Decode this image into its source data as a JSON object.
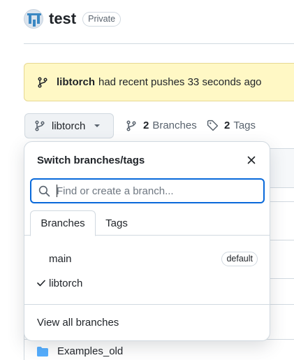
{
  "repo": {
    "name": "test",
    "visibility": "Private"
  },
  "flash": {
    "branch": "libtorch",
    "message": "had recent pushes 33 seconds ago"
  },
  "branch_selector": {
    "current": "libtorch"
  },
  "meta": {
    "branches_count": "2",
    "branches_label": "Branches",
    "tags_count": "2",
    "tags_label": "Tags"
  },
  "dropdown": {
    "title": "Switch branches/tags",
    "search_placeholder": "Find or create a branch...",
    "tabs": [
      "Branches",
      "Tags"
    ],
    "items": [
      {
        "name": "main",
        "badge": "default",
        "selected": false
      },
      {
        "name": "libtorch",
        "badge": "",
        "selected": true
      }
    ],
    "footer": "View all branches"
  },
  "files": {
    "visible_row": "Examples_old"
  },
  "colors": {
    "accent": "#0969da",
    "flash_bg": "#fff8c5",
    "border": "#d1d9e0",
    "folder": "#54aeff"
  }
}
